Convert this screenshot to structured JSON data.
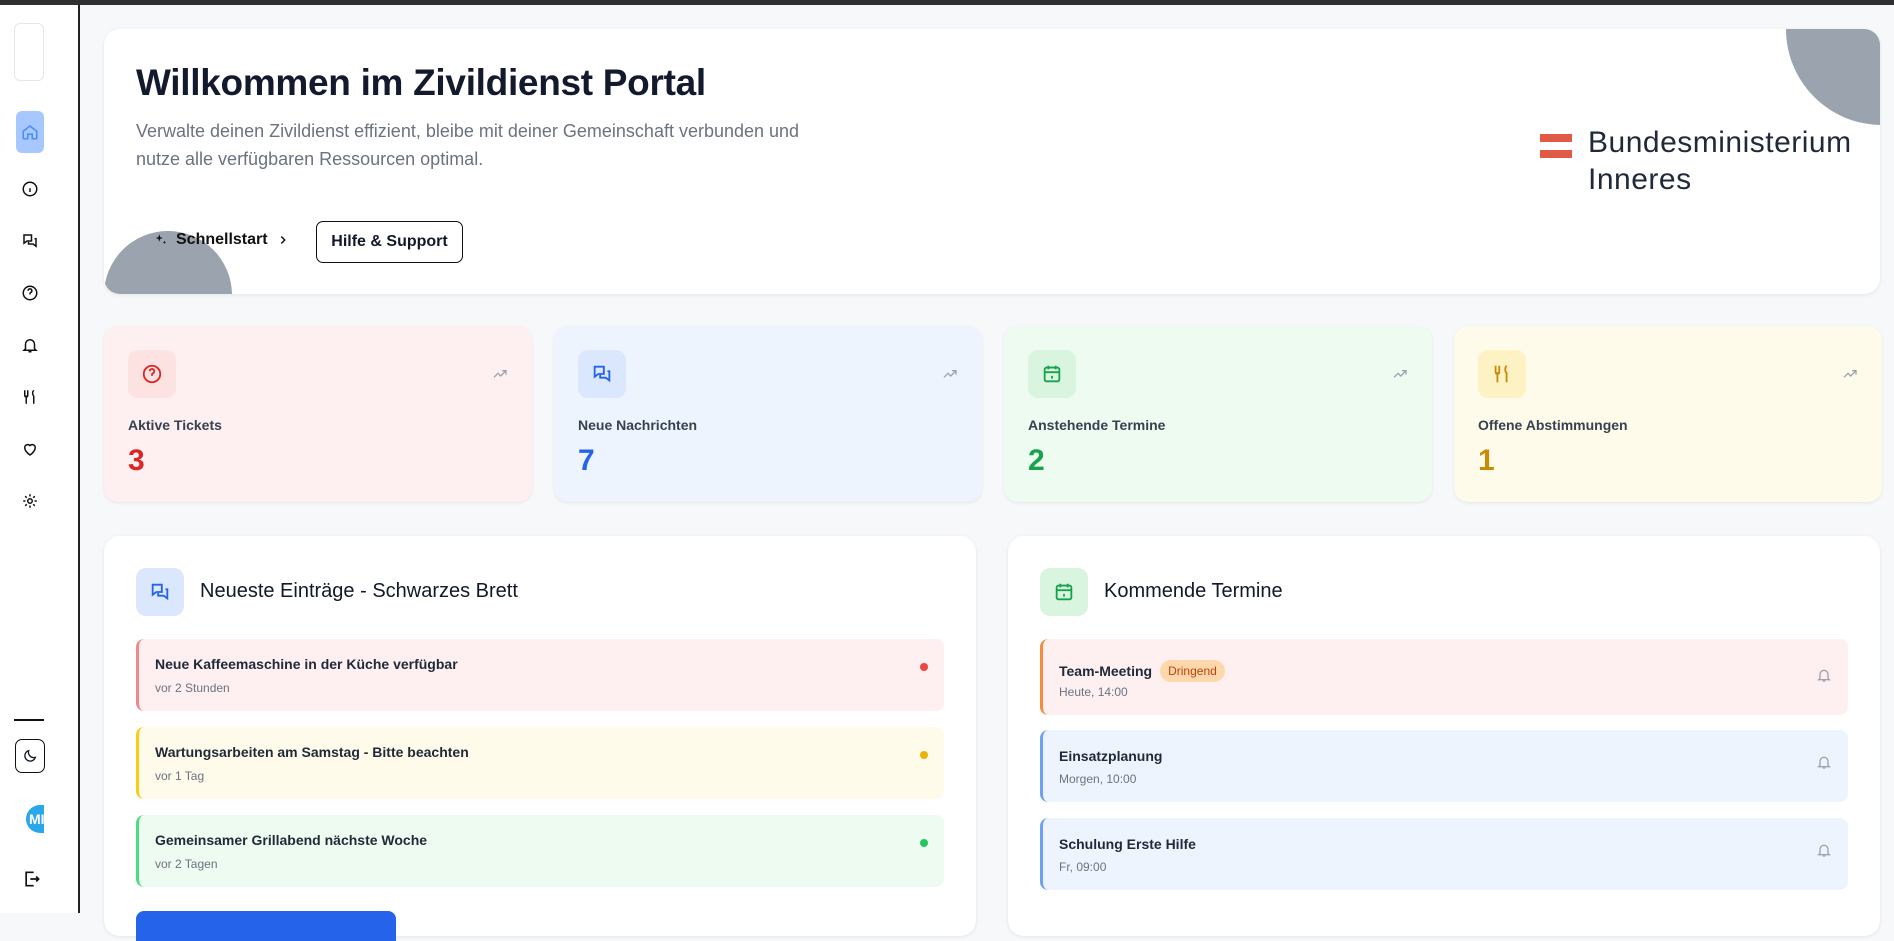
{
  "hero": {
    "title": "Willkommen im Zivildienst Portal",
    "description": "Verwalte deinen Zivildienst effizient, bleibe mit deiner Gemeinschaft verbunden und nutze alle verfügbaren Ressourcen optimal.",
    "quickstart_label": "Schnellstart",
    "help_label": "Hilfe & Support",
    "ministry_line1": "Bundesministerium",
    "ministry_line2": "Inneres"
  },
  "sidebar": {
    "avatar_initials": "MI",
    "items": [
      "home-icon",
      "info-icon",
      "messages-icon",
      "help-icon",
      "bell-icon",
      "utensils-icon",
      "heart-icon",
      "settings-icon"
    ]
  },
  "stats": [
    {
      "label": "Aktive Tickets",
      "value": "3",
      "color": "#dc2626",
      "bg": "#fef0f0",
      "icon_bg": "#fde2e2"
    },
    {
      "label": "Neue Nachrichten",
      "value": "7",
      "color": "#2563eb",
      "bg": "#eef4fe",
      "icon_bg": "#dbe7fd"
    },
    {
      "label": "Anstehende Termine",
      "value": "2",
      "color": "#16a34a",
      "bg": "#eefbf1",
      "icon_bg": "#d9f5e0"
    },
    {
      "label": "Offene Abstimmungen",
      "value": "1",
      "color": "#ca8a04",
      "bg": "#fefbea",
      "icon_bg": "#fdf2c4"
    }
  ],
  "board": {
    "title": "Neueste Einträge - Schwarzes Brett",
    "entries": [
      {
        "title": "Neue Kaffeemaschine in der Küche verfügbar",
        "time": "vor 2 Stunden"
      },
      {
        "title": "Wartungsarbeiten am Samstag - Bitte beachten",
        "time": "vor 1 Tag"
      },
      {
        "title": "Gemeinsamer Grillabend nächste Woche",
        "time": "vor 2 Tagen"
      }
    ]
  },
  "events": {
    "title": "Kommende Termine",
    "entries": [
      {
        "title": "Team-Meeting",
        "badge": "Dringend",
        "time": "Heute, 14:00"
      },
      {
        "title": "Einsatzplanung",
        "time": "Morgen, 10:00"
      },
      {
        "title": "Schulung Erste Hilfe",
        "time": "Fr, 09:00"
      }
    ]
  },
  "colors": {
    "brand_red": "#e05a47",
    "accent_blue": "#2563eb"
  }
}
